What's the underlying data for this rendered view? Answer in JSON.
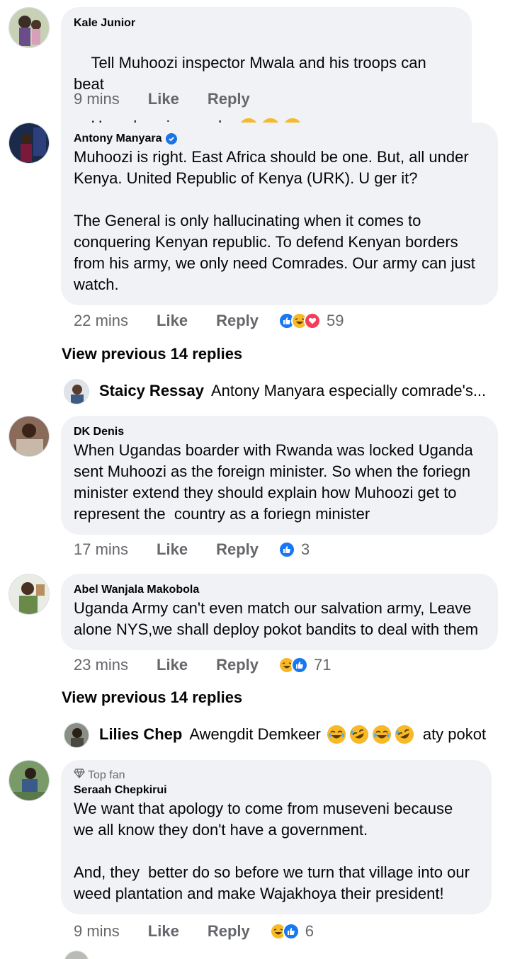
{
  "comments": [
    {
      "author": "Kale Junior",
      "lines": [
        "Tell Muhoozi inspector Mwala and his troops can beat",
        "Ugandans in one day"
      ],
      "time": "9 mins",
      "like": "Like",
      "reply": "Reply",
      "emojis": [
        "tears-of-joy",
        "tears-of-joy",
        "tears-of-joy"
      ]
    },
    {
      "author": "Antony Manyara",
      "verified": true,
      "text": "Muhoozi is right. East Africa should be one. But, all under\nKenya. United Republic of Kenya (URK). U ger it?\n\nThe General is only hallucinating when it comes to\nconquering Kenyan republic. To defend Kenyan borders\nfrom his army, we only need Comrades. Our army can just\nwatch.",
      "time": "22 mins",
      "like": "Like",
      "reply": "Reply",
      "reactions": [
        "like",
        "haha",
        "love"
      ],
      "reaction_count": "59"
    },
    {
      "author": "DK Denis",
      "text": "When Ugandas boarder with Rwanda was locked Uganda\nsent Muhoozi as the foreign minister. So when the foriegn\nminister extend they should explain how Muhoozi get to\nrepresent the  country as a foriegn minister",
      "time": "17 mins",
      "like": "Like",
      "reply": "Reply",
      "reactions": [
        "like"
      ],
      "reaction_count": "3"
    },
    {
      "author": "Abel Wanjala Makobola",
      "text": "Uganda Army can't even match our salvation army, Leave\nalone NYS,we shall deploy pokot bandits to deal with them",
      "time": "23 mins",
      "like": "Like",
      "reply": "Reply",
      "reactions": [
        "haha",
        "like"
      ],
      "reaction_count": "71"
    },
    {
      "badge": "Top fan",
      "author": "Seraah Chepkirui",
      "text": "We want that apology to come from museveni because\nwe all know they don't have a government.\n\nAnd, they  better do so before we turn that village into our\nweed plantation and make Wajakhoya their president!",
      "time": "9 mins",
      "like": "Like",
      "reply": "Reply",
      "reactions": [
        "haha",
        "like"
      ],
      "reaction_count": "6"
    }
  ],
  "view_previous": [
    "View previous 14 replies",
    "View previous 14 replies"
  ],
  "reply_previews": [
    {
      "name": "Staicy Ressay",
      "text": "Antony Manyara especially comrade's..."
    },
    {
      "name": "Lilies Chep",
      "text_before": "Awengdit Demkeer",
      "text_after": "aty pokot"
    }
  ],
  "colors": {
    "bubble": "#f0f2f5",
    "meta": "#65676b",
    "like_blue": "#1877f2",
    "haha_yellow": "#f7b928",
    "love_red": "#f33e58"
  }
}
